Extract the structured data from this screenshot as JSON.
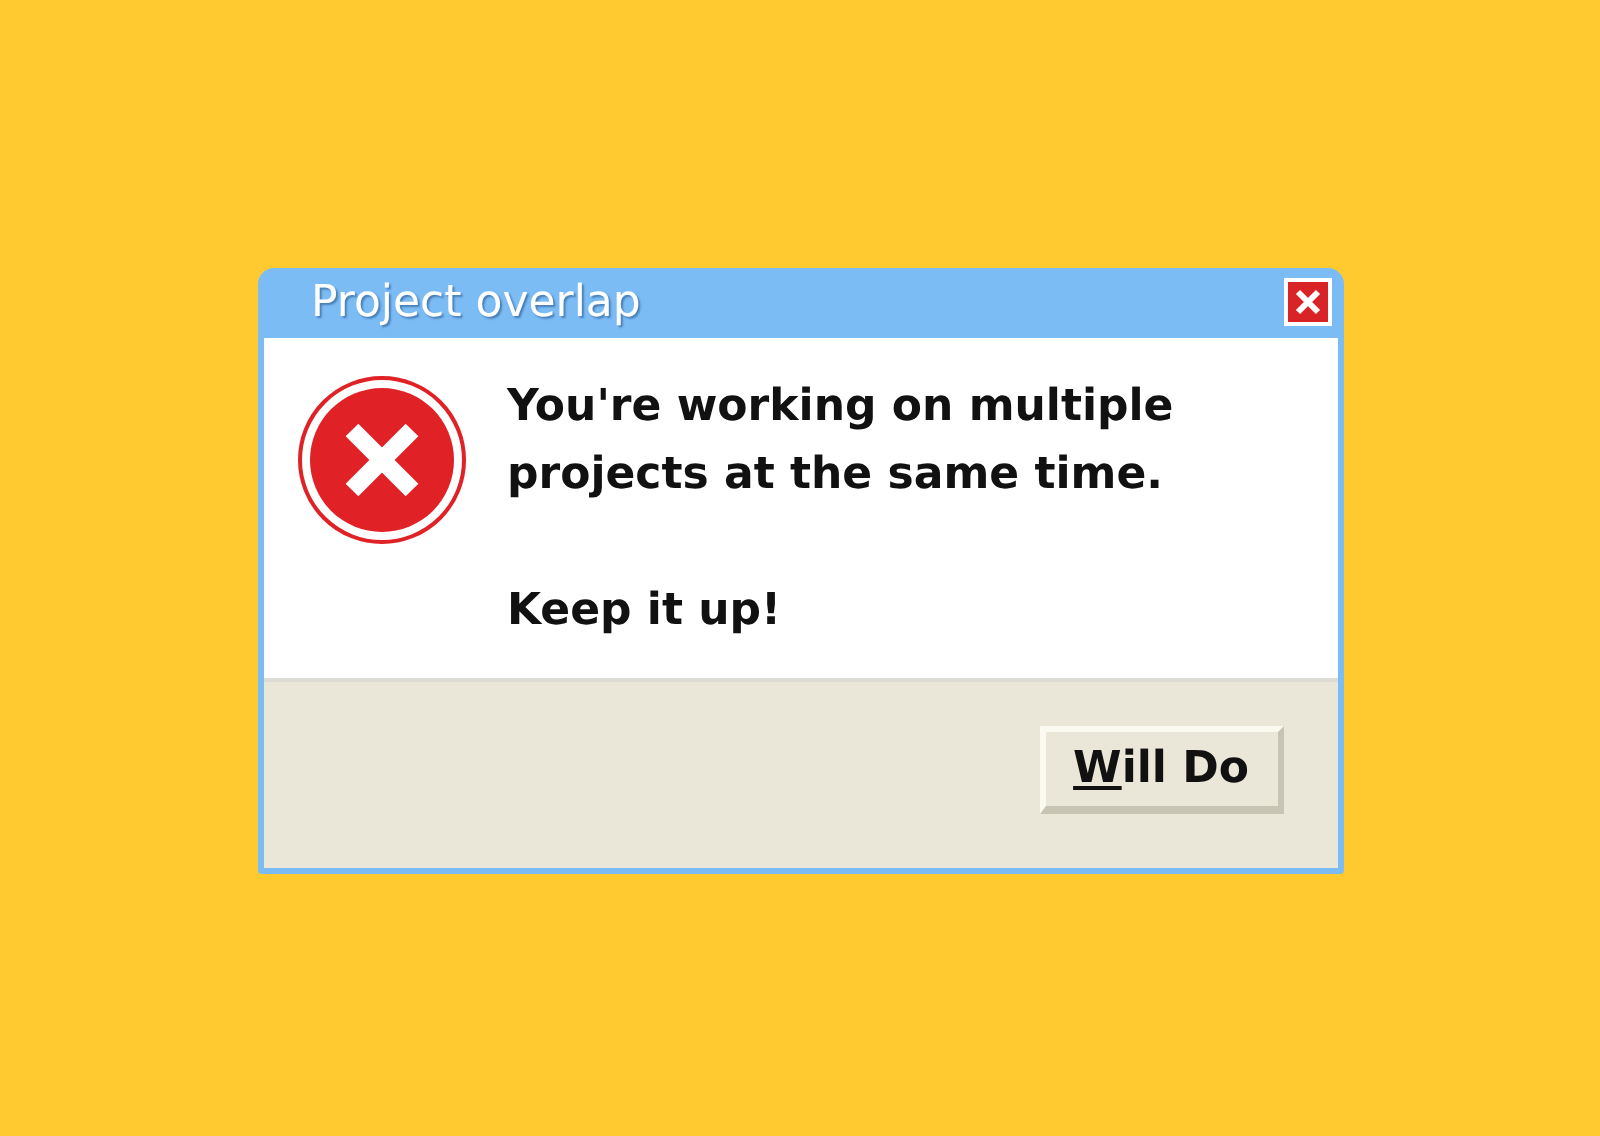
{
  "window": {
    "title": "Project overlap"
  },
  "message": {
    "lines": [
      "You're working on multiple projects at the same time.",
      "Keep it up!"
    ]
  },
  "buttons": [
    {
      "mnemonic": "W",
      "label_rest": "ill Do"
    }
  ]
}
